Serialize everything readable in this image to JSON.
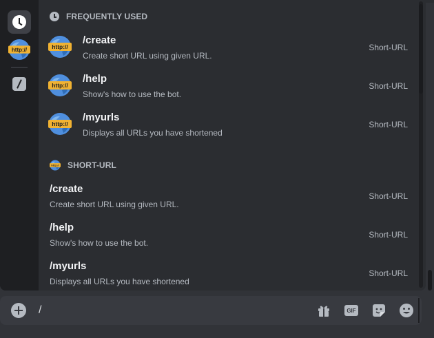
{
  "rail": {
    "items": [
      {
        "icon": "clock-icon",
        "active": true
      },
      {
        "icon": "short-url-app-icon",
        "active": false
      },
      {
        "icon": "slash-command-icon",
        "active": false
      }
    ]
  },
  "sections": {
    "frequently_used": {
      "title": "FREQUENTLY USED",
      "commands": [
        {
          "name": "/create",
          "description": "Create short URL using given URL.",
          "source": "Short-URL"
        },
        {
          "name": "/help",
          "description": "Show's how to use the bot.",
          "source": "Short-URL"
        },
        {
          "name": "/myurls",
          "description": "Displays all URLs you have shortened",
          "source": "Short-URL"
        }
      ]
    },
    "short_url": {
      "title": "SHORT-URL",
      "commands": [
        {
          "name": "/create",
          "description": "Create short URL using given URL.",
          "source": "Short-URL"
        },
        {
          "name": "/help",
          "description": "Show's how to use the bot.",
          "source": "Short-URL"
        },
        {
          "name": "/myurls",
          "description": "Displays all URLs you have shortened",
          "source": "Short-URL"
        }
      ]
    }
  },
  "app_logo": {
    "text": "http://"
  },
  "composer": {
    "value": "/",
    "gif_label": "GIF"
  },
  "colors": {
    "background": "#313338",
    "popup": "#2b2d31",
    "rail": "#1e1f22",
    "primary_text": "#f2f3f5",
    "secondary_text": "#b5bac1",
    "logo_orange": "#f0b232",
    "logo_blue": "#5865f2"
  }
}
